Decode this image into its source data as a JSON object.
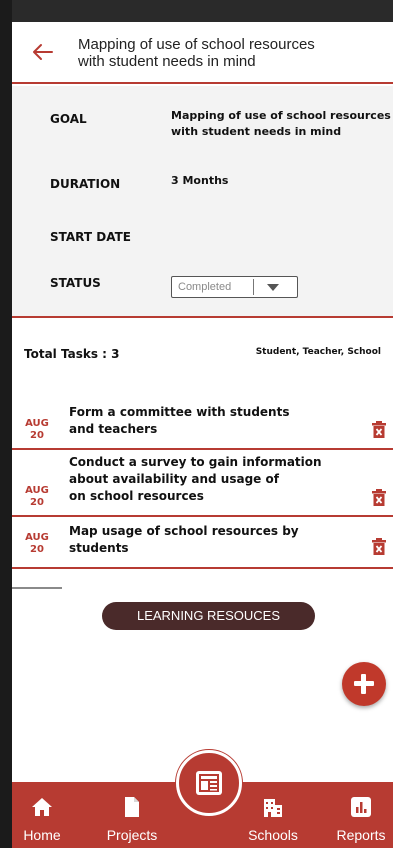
{
  "header": {
    "title_line1": "Mapping of use of school resources",
    "title_line2": "with student needs in mind"
  },
  "details": {
    "goal_label": "GOAL",
    "goal_value_line1": "Mapping of use of school resources",
    "goal_value_line2": "with student needs in mind",
    "duration_label": "DURATION",
    "duration_value": "3 Months",
    "start_date_label": "START DATE",
    "status_label": "STATUS",
    "status_value": "Completed"
  },
  "tasks_summary": {
    "total_label": "Total Tasks : 3",
    "roles": "Student, Teacher, School"
  },
  "tasks": [
    {
      "month": "AUG",
      "day": "20",
      "lines": [
        "Form a committee with students",
        "and teachers"
      ]
    },
    {
      "month": "AUG",
      "day": "20",
      "lines": [
        "Conduct a survey to gain information",
        "about availability and usage of",
        "on school resources"
      ]
    },
    {
      "month": "AUG",
      "day": "20",
      "lines": [
        "Map usage of school resources by",
        "students"
      ]
    }
  ],
  "learning_resources_label": "LEARNING RESOUCES",
  "nav": {
    "home": "Home",
    "projects": "Projects",
    "schools": "Schools",
    "reports": "Reports"
  },
  "colors": {
    "accent": "#b73b32",
    "dark_button": "#4a2a2a",
    "info_bg": "#f3f3f3"
  },
  "icons": [
    "back-arrow-icon",
    "trash-icon",
    "plus-icon",
    "home-icon",
    "document-icon",
    "building-icon",
    "bar-chart-icon",
    "newspaper-icon"
  ]
}
